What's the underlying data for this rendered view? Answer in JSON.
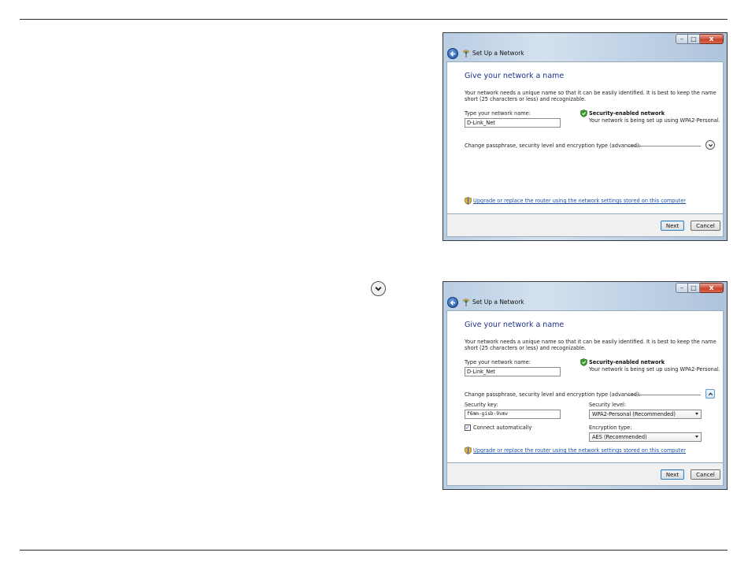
{
  "dialog": {
    "title": "Set Up a Network",
    "heading": "Give your network a name",
    "description": "Your network needs a unique name so that it can be easily identified. It is best to keep the name short (25 characters or less) and recognizable.",
    "name_label": "Type your network name:",
    "name_value": "D-Link_Net",
    "security_title": "Security-enabled network",
    "security_sub": "Your network is being set up using WPA2-Personal.",
    "advanced_label": "Change passphrase, security level and encryption type (advanced):",
    "upgrade_link": "Upgrade or replace the router using the network settings stored on this computer",
    "next_label": "Next",
    "cancel_label": "Cancel",
    "security_key_label": "Security key:",
    "security_key_value": "f6mm-gisb-9vmv",
    "security_level_label": "Security level:",
    "security_level_value": "WPA2-Personal (Recommended)",
    "connect_auto_label": "Connect automatically",
    "connect_auto_checked": true,
    "encryption_label": "Encryption type:",
    "encryption_value": "AES (Recommended)"
  },
  "icons": {
    "floating": "chevron-down-circle-icon",
    "back": "back-arrow-icon",
    "network": "network-icon",
    "shield": "shield-icon",
    "collapse": "chevron-up-icon",
    "expand": "chevron-down-icon"
  },
  "colors": {
    "heading": "#1e3287",
    "link": "#1a4fa6",
    "shield_green": "#3c9a2e"
  }
}
